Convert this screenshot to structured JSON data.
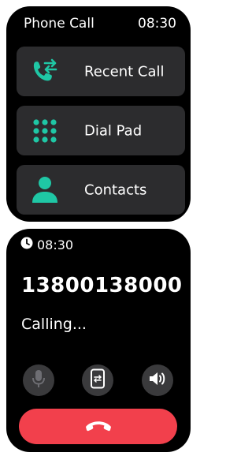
{
  "menu": {
    "title": "Phone Call",
    "time": "08:30",
    "items": [
      {
        "label": "Recent Call",
        "icon": "recent-call-icon"
      },
      {
        "label": "Dial Pad",
        "icon": "dial-pad-icon"
      },
      {
        "label": "Contacts",
        "icon": "contact-icon"
      }
    ]
  },
  "call": {
    "time": "08:30",
    "number": "13800138000",
    "status": "Calling...",
    "buttons": [
      {
        "name": "microphone",
        "icon": "microphone-icon"
      },
      {
        "name": "phone-audio",
        "icon": "phone-device-icon"
      },
      {
        "name": "speaker",
        "icon": "speaker-icon"
      }
    ],
    "end_icon": "end-call-icon"
  },
  "colors": {
    "accent": "#1fc7a5",
    "end_call": "#f2404c",
    "tile": "#2c2c2e",
    "round_button": "#3a3a3c"
  }
}
